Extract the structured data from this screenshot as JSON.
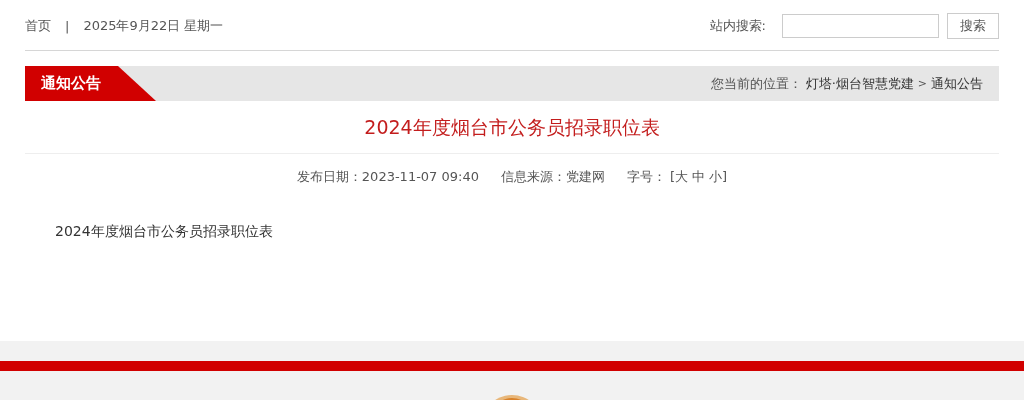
{
  "top_bar": {
    "home_link": "首页",
    "separator": "|",
    "date": "2025年9月22日 星期一",
    "search_label": "站内搜索:",
    "search_button": "搜索"
  },
  "section_bar": {
    "title": "通知公告",
    "location_label": "您当前的位置：",
    "breadcrumb": [
      {
        "label": "灯塔·烟台智慧党建"
      },
      {
        "label": "通知公告"
      }
    ],
    "breadcrumb_separator": ">"
  },
  "article": {
    "title": "2024年度烟台市公务员招录职位表",
    "meta": [
      {
        "label": "发布日期：",
        "value": "2023-11-07 09:40"
      },
      {
        "label": "信息来源：",
        "value": "党建网"
      }
    ],
    "font_size_label": "字号：",
    "font_sizes": [
      "[大",
      "中",
      "小]"
    ],
    "body": "2024年度烟台市公务员招录职位表"
  }
}
